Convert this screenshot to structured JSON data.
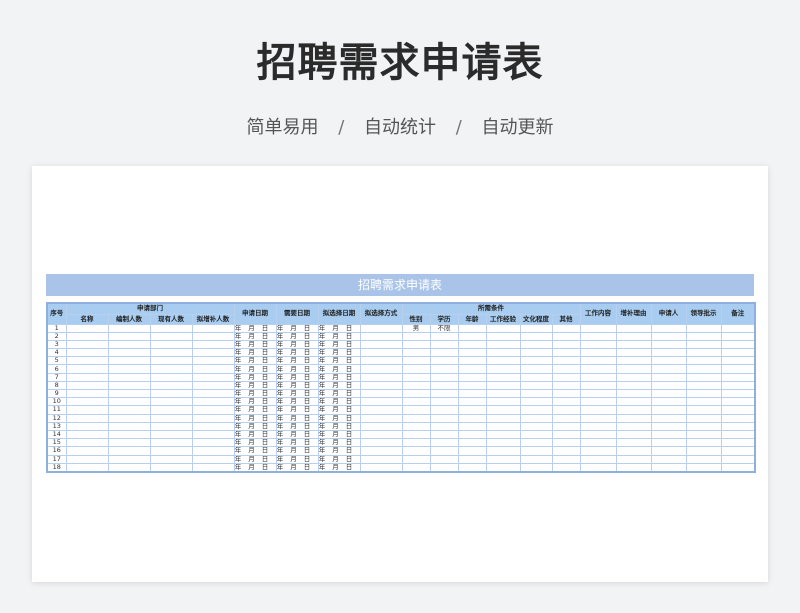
{
  "title": "招聘需求申请表",
  "subtitle": [
    "简单易用",
    "自动统计",
    "自动更新"
  ],
  "subtitle_sep": "/",
  "sheet": {
    "banner": "招聘需求申请表",
    "headers": {
      "seq": "序号",
      "dept": "申请部门",
      "dept_sub": [
        "名称",
        "编制人数",
        "现有人数",
        "拟增补人数"
      ],
      "apply_date": "申请日期",
      "need_date": "需要日期",
      "select_date": "拟选择日期",
      "select_method": "拟选择方式",
      "conditions": "所需条件",
      "cond_sub": [
        "性别",
        "学历",
        "年龄",
        "工作经验",
        "文化程度",
        "其他"
      ],
      "job": "工作内容",
      "reason": "增补理由",
      "applicant": "申请人",
      "leader": "领导批示",
      "remark": "备注"
    },
    "date_parts": [
      "年",
      "月",
      "日"
    ],
    "first_row": {
      "gender": "男",
      "education": "不限"
    },
    "row_numbers": [
      "1",
      "2",
      "3",
      "4",
      "5",
      "6",
      "7",
      "8",
      "9",
      "10",
      "11",
      "12",
      "13",
      "14",
      "15",
      "16",
      "17",
      "18"
    ]
  },
  "colors": {
    "header_bg": "#a8cdf0",
    "banner_bg": "#a9c4e8",
    "border": "#b9cfee"
  }
}
